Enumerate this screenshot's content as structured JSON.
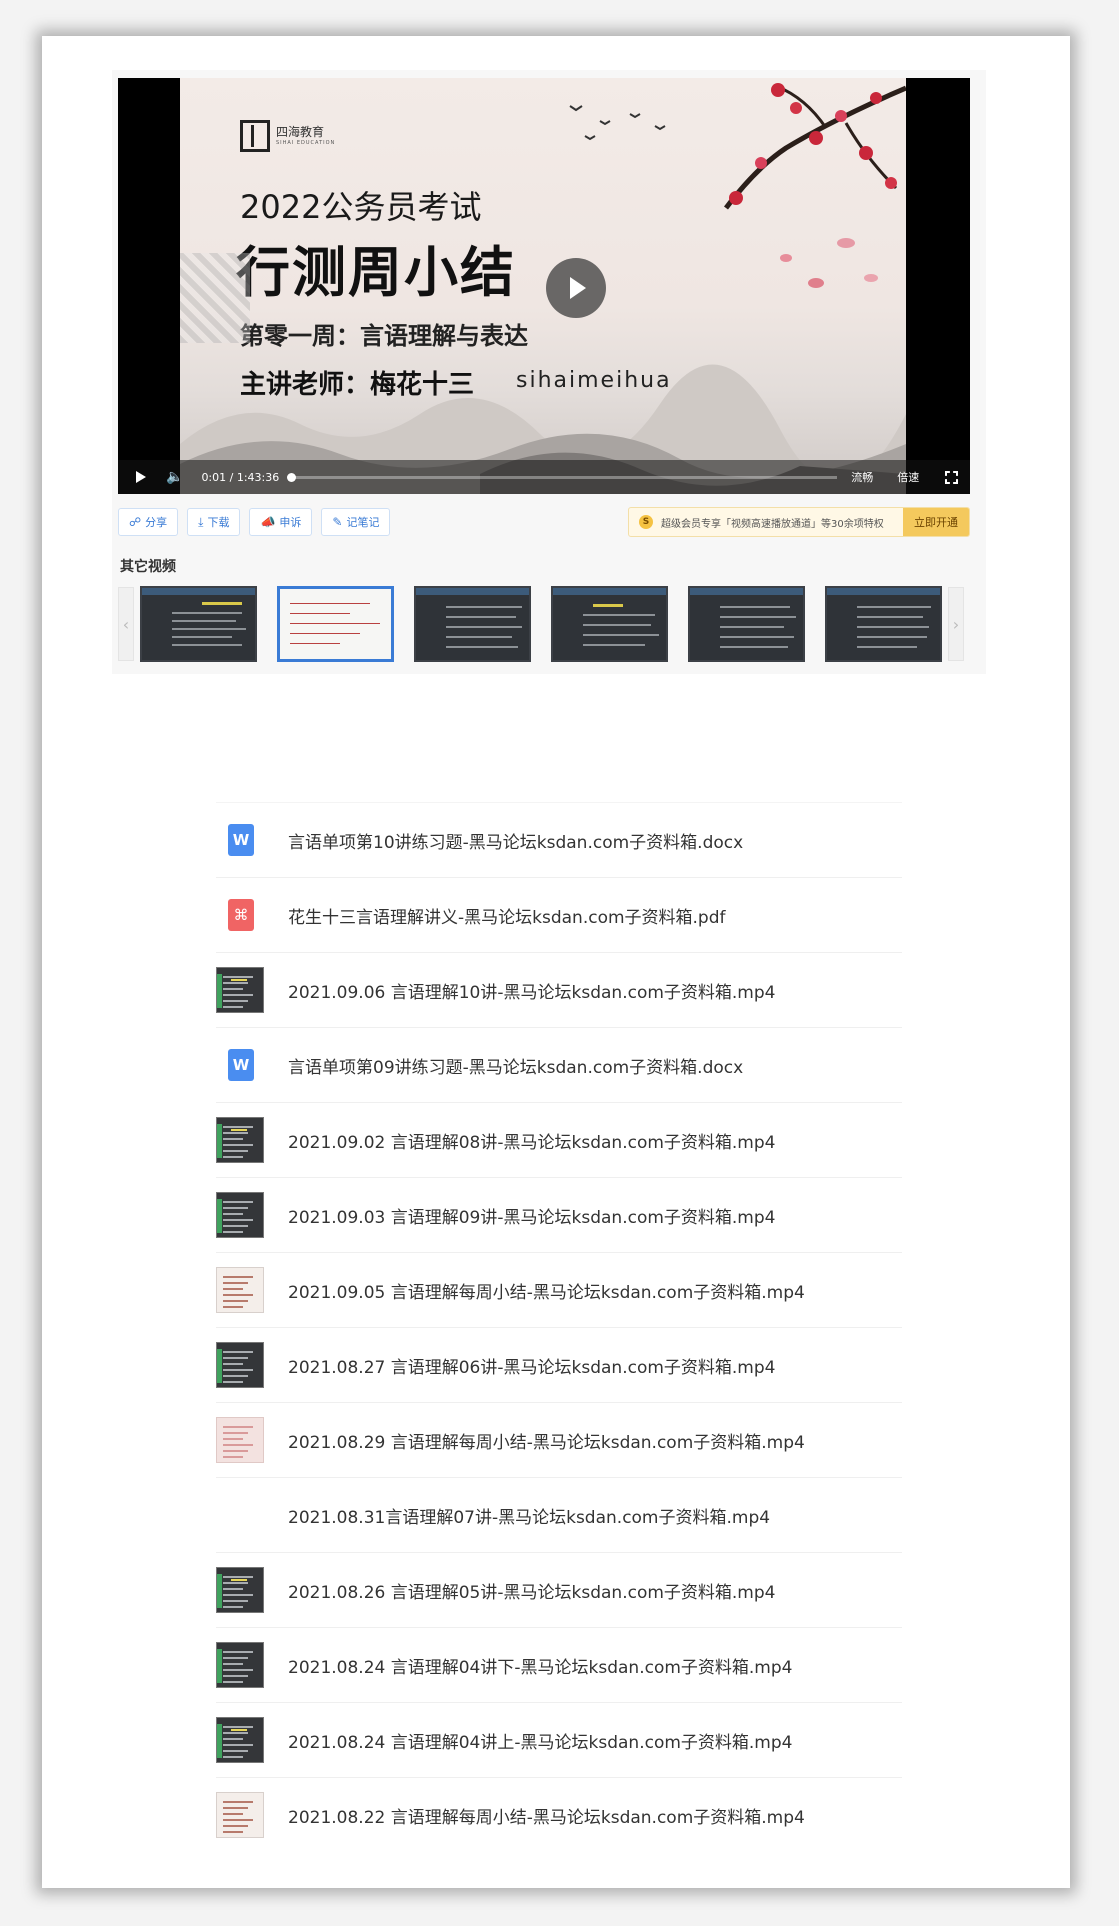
{
  "player": {
    "poster": {
      "brand_cn": "四海教育",
      "brand_en": "SIHAI EDUCATION",
      "year_line": "2022公务员考试",
      "title": "行测周小结",
      "week_line": "第零一周：言语理解与表达",
      "teacher_line": "主讲老师：梅花十三",
      "pinyin": "sihaimeihua"
    },
    "controls": {
      "time": "0:01 / 1:43:36",
      "progress_fraction": 0.0,
      "quality": "流畅",
      "speed": "倍速"
    }
  },
  "toolbar": {
    "share": "分享",
    "download": "下载",
    "report": "申诉",
    "notes": "记笔记",
    "vip_badge": "S",
    "vip_text": "超级会员专享「视频高速播放通道」等30余项特权",
    "vip_button": "立即开通"
  },
  "other_videos": {
    "heading": "其它视频",
    "prev_arrow": "‹",
    "next_arrow": "›"
  },
  "files": [
    {
      "name": "言语单项第10讲练习题-黑马论坛ksdan.com子资料箱.docx",
      "type": "docx"
    },
    {
      "name": "花生十三言语理解讲义-黑马论坛ksdan.com子资料箱.pdf",
      "type": "pdf"
    },
    {
      "name": "2021.09.06 言语理解10讲-黑马论坛ksdan.com子资料箱.mp4",
      "type": "mp4"
    },
    {
      "name": "言语单项第09讲练习题-黑马论坛ksdan.com子资料箱.docx",
      "type": "docx"
    },
    {
      "name": "2021.09.02 言语理解08讲-黑马论坛ksdan.com子资料箱.mp4",
      "type": "mp4"
    },
    {
      "name": "2021.09.03 言语理解09讲-黑马论坛ksdan.com子资料箱.mp4",
      "type": "mp4"
    },
    {
      "name": "2021.09.05 言语理解每周小结-黑马论坛ksdan.com子资料箱.mp4",
      "type": "mp4-light"
    },
    {
      "name": "2021.08.27 言语理解06讲-黑马论坛ksdan.com子资料箱.mp4",
      "type": "mp4"
    },
    {
      "name": "2021.08.29 言语理解每周小结-黑马论坛ksdan.com子资料箱.mp4",
      "type": "mp4-pink"
    },
    {
      "name": "2021.08.31言语理解07讲-黑马论坛ksdan.com子资料箱.mp4",
      "type": "mp4-blank"
    },
    {
      "name": "2021.08.26 言语理解05讲-黑马论坛ksdan.com子资料箱.mp4",
      "type": "mp4"
    },
    {
      "name": "2021.08.24 言语理解04讲下-黑马论坛ksdan.com子资料箱.mp4",
      "type": "mp4"
    },
    {
      "name": "2021.08.24 言语理解04讲上-黑马论坛ksdan.com子资料箱.mp4",
      "type": "mp4"
    },
    {
      "name": "2021.08.22 言语理解每周小结-黑马论坛ksdan.com子资料箱.mp4",
      "type": "mp4-light"
    }
  ]
}
